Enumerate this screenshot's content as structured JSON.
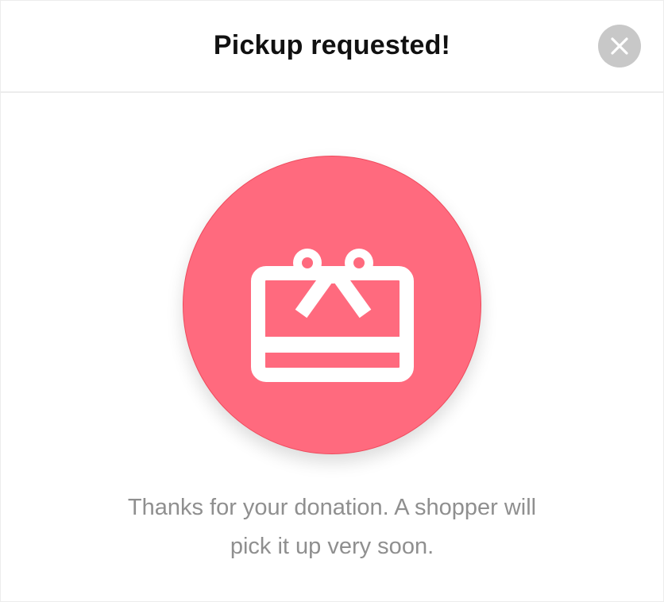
{
  "modal": {
    "title": "Pickup requested!",
    "close_icon": "close-icon",
    "hero_icon": "gift-card-icon",
    "message_lines": [
      "Thanks for your donation. A shopper will",
      "pick it up very soon."
    ]
  },
  "colors": {
    "accent": "#ff6a7e",
    "accent_border": "#ef4a5c",
    "close_bg": "#c8c8c8",
    "title_text": "#111111",
    "message_text": "#8f8f8f",
    "divider": "#ececec"
  }
}
